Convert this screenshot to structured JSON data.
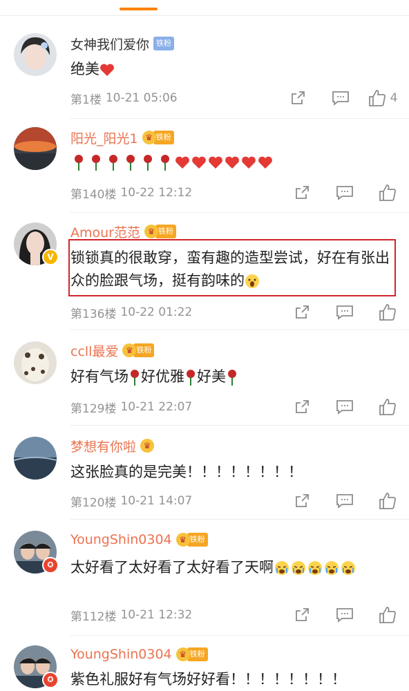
{
  "tabs": {
    "active_indicator_color": "#ff8200"
  },
  "comments": [
    {
      "username": "女神我们爱你",
      "name_color": "#333333",
      "fan_badge": "铁粉",
      "text": "绝美",
      "emoji": "red-heart",
      "floor": "第1楼",
      "time": "10-21 05:06",
      "likes": "4"
    },
    {
      "username": "阳光_阳光1",
      "name_color": "#eb7350",
      "fan_badge": "铁粉",
      "text": "",
      "emoji": "6 roses + 6 red hearts",
      "floor": "第140楼",
      "time": "10-22 12:12",
      "likes": ""
    },
    {
      "username": "Amour范范",
      "name_color": "#eb7350",
      "fan_badge": "铁粉",
      "text": "锁锁真的很敢穿，蛮有趣的造型尝试，好在有张出众的脸跟气场，挺有韵味的",
      "emoji": "shocked-face",
      "floor": "第136楼",
      "time": "10-22 01:22",
      "likes": "",
      "verified": "V",
      "highlighted": true
    },
    {
      "username": "ccll最爱",
      "name_color": "#eb7350",
      "fan_badge": "铁粉",
      "text_parts": [
        "好有气场",
        "好优雅",
        "好美"
      ],
      "emoji": "rose",
      "floor": "第129楼",
      "time": "10-21 22:07",
      "likes": ""
    },
    {
      "username": "梦想有你啦",
      "name_color": "#eb7350",
      "text": "这张脸真的是完美！！！！！！！！",
      "floor": "第120楼",
      "time": "10-21 14:07",
      "likes": ""
    },
    {
      "username": "YoungShin0304",
      "name_color": "#eb7350",
      "fan_badge": "铁粉",
      "text": "太好看了太好看了太好看了天啊",
      "emoji": "crying-face x5",
      "floor": "第112楼",
      "time": "10-21 12:32",
      "likes": ""
    },
    {
      "username": "YoungShin0304",
      "name_color": "#eb7350",
      "fan_badge": "铁粉",
      "text": "紫色礼服好有气场好好看！！！！！！！！",
      "floor": "",
      "time": "",
      "likes": ""
    }
  ],
  "colors": {
    "name_orange": "#eb7350",
    "meta_grey": "#939393",
    "highlight_red": "#d2232a",
    "fan_badge_gold": "#f5a623",
    "fan_badge_blue": "#8aaee8"
  }
}
